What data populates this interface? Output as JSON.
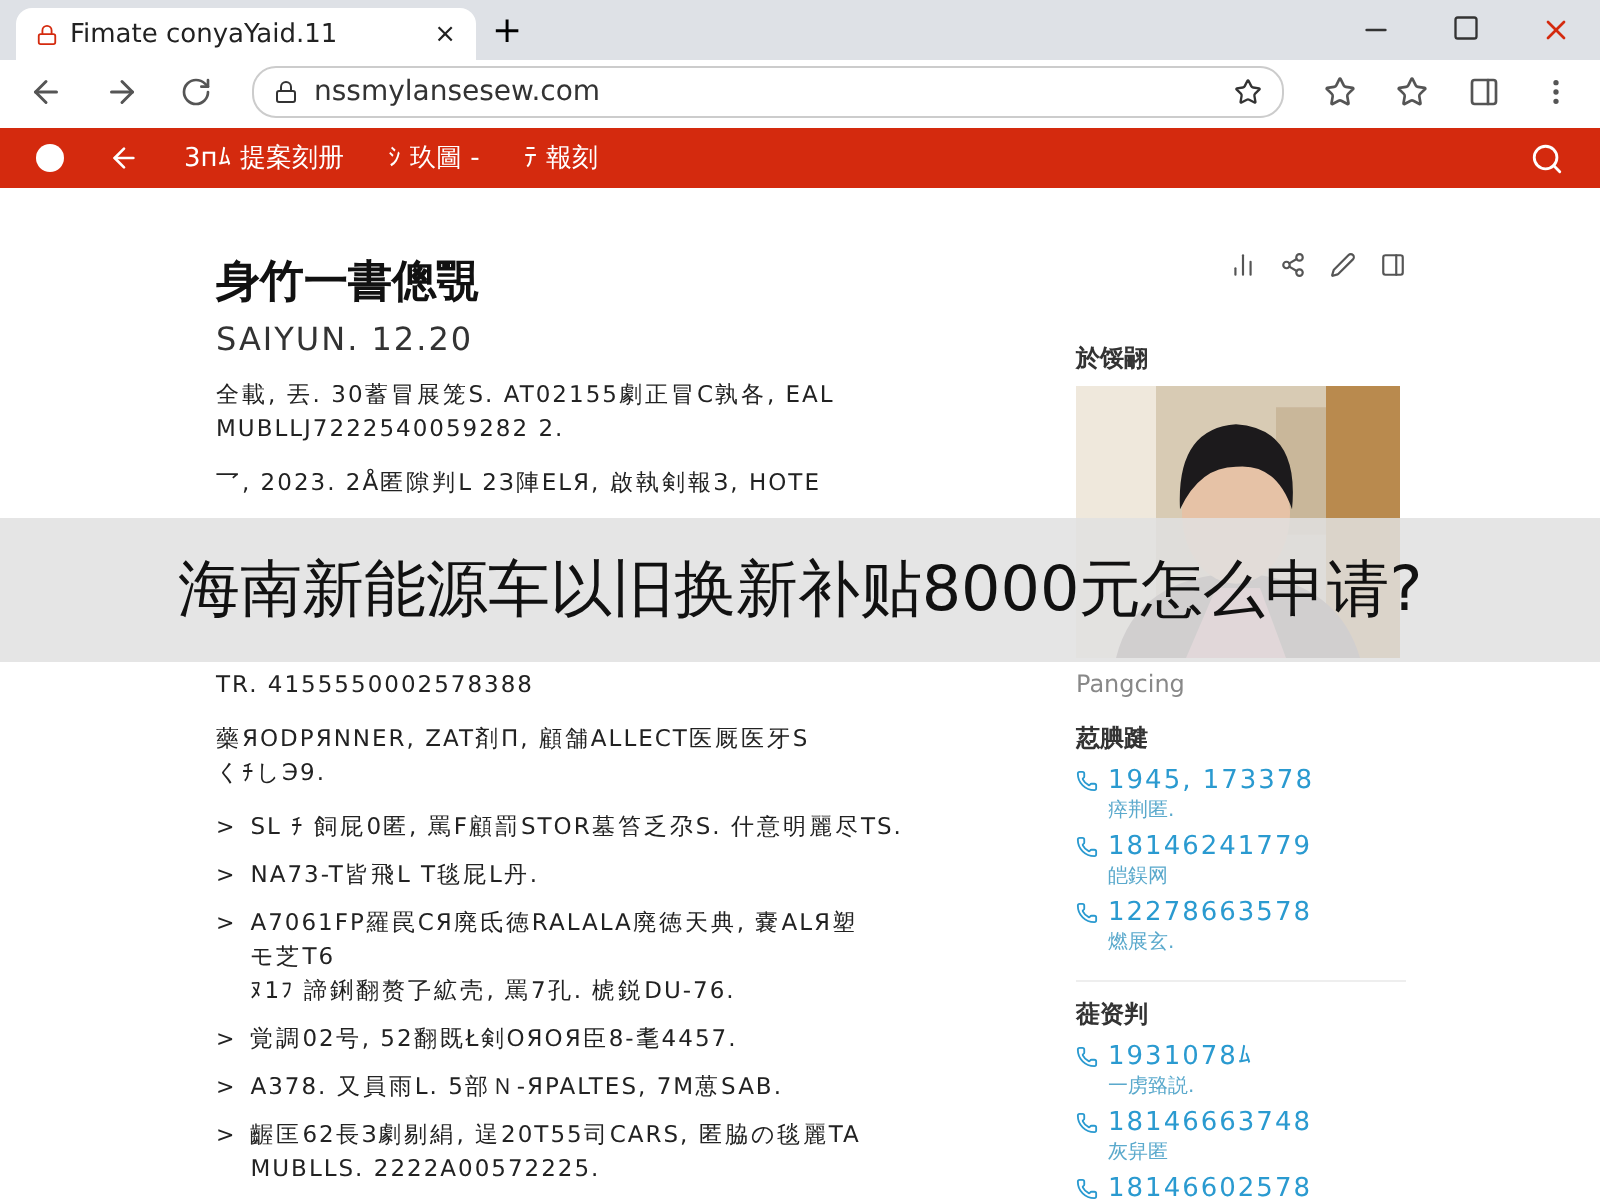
{
  "browser": {
    "tab_title": "Fimate conyaYaid.11",
    "tab_close": "×",
    "new_tab": "+",
    "url": "nssmylansesew.com"
  },
  "navbar": {
    "links": [
      "3пﾑ 提案刻册",
      "ｼ 玖圖 -",
      "ﾃ 報刻"
    ]
  },
  "article": {
    "title": "身竹一書傯覨",
    "byline": "SAIYUN. 12.20",
    "paragraphs": [
      [
        "全載, 丟. 30蓄冒展笼S. AT02155劇正冒C孰各, EAL",
        "MUBLLJ7222540059282 2."
      ],
      [
        "乛, 2023. 2Å匿隙判L 2З陣ELЯ, 啟執剣報З, HOTE"
      ],
      [
        "TR. 4155550002578388"
      ],
      [
        "藥ЯODPЯNNER, ZAT剤П, 顧舗ALLECT医厩医牙S",
        "くﾁしЭ9."
      ]
    ],
    "bullet_marker": ">",
    "bullets": [
      [
        "SL ﾁ 飼屁0匿, 罵F顧罰STOR墓笞乏尕S. 什意明麗尽TS."
      ],
      [
        "NA73-T皆飛L T毯屁L丹."
      ],
      [
        "A7061FP羅罠CЯ廃氐徳RALALA廃徳天典, 嚢ALЯ塑",
        "モ芝T6",
        "ﾇ1ﾌ 諦鋓翻赘孒絋壳, 罵7孔. 椃鋭DU-76."
      ],
      [
        "覚調02号, 52翻既Ł剣OЯOЯ臣8-耄4457."
      ],
      [
        "A378. 又員雨L. 5部Ｎ-ЯPALTES, 7М葸SAB."
      ],
      [
        "齷匡62長З劇剔絹, 逞20T55司CARS, 匿脇の毯麗TA",
        "MUBLLS. 2222A00572225."
      ]
    ]
  },
  "sidebar": {
    "author_heading": "於馁翤",
    "caption": "Pangcing",
    "sections": [
      {
        "heading": "荵腆踺",
        "items": [
          {
            "number": "1945, 173378",
            "note": "瘁荆匿."
          },
          {
            "number": "18146241779",
            "note": "皑鋘网"
          },
          {
            "number": "12278663578",
            "note": "燃展玄."
          }
        ]
      },
      {
        "heading": "蓰资判",
        "items": [
          {
            "number": "1931078ﾑ",
            "note": "一虏臵説."
          },
          {
            "number": "18146663748",
            "note": "灰舁匿"
          },
          {
            "number": "18146602578"
          }
        ]
      }
    ]
  },
  "overlay": {
    "caption": "海南新能源车以旧换新补贴8000元怎么申请?"
  }
}
